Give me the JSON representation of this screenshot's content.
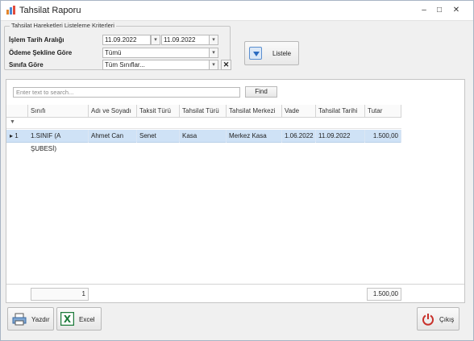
{
  "window": {
    "title": "Tahsilat Raporu",
    "controls": {
      "minimize": "–",
      "maximize": "□",
      "close": "✕"
    }
  },
  "criteria": {
    "group_title": "Tahsilat Hareketleri Listeleme Kriterleri",
    "date_range_label": "İşlem Tarih Aralığı",
    "date_from": "11.09.2022",
    "date_to": "11.09.2022",
    "payment_label": "Ödeme Şekline Göre",
    "payment_value": "Tümü",
    "class_label": "Sınıfa Göre",
    "class_value": "Tüm Sınıflar...",
    "list_button": "Listele"
  },
  "search": {
    "placeholder": "Enter text to search...",
    "find_button": "Find"
  },
  "grid": {
    "columns": [
      "Sınıfı",
      "Adı ve Soyadı",
      "Taksit Türü",
      "Tahsilat Türü",
      "Tahsilat Merkezi",
      "Vade",
      "Tahsilat Tarihi",
      "Tutar"
    ],
    "filter_icon": "filter-icon",
    "rows": [
      {
        "index": "1",
        "cells": [
          "1.SINIF (A ŞUBESİ)",
          "Ahmet Can",
          "Senet",
          "Kasa",
          "Merkez Kasa",
          "1.06.2022",
          "11.09.2022",
          "1.500,00"
        ]
      }
    ],
    "footer_count": "1",
    "footer_total": "1.500,00"
  },
  "buttons": {
    "print": "Yazdır",
    "excel": "Excel",
    "exit": "Çıkış"
  },
  "colors": {
    "selected_row": "#cfe2f6",
    "excel_green": "#1e7b3c",
    "exit_red": "#c8312b"
  }
}
